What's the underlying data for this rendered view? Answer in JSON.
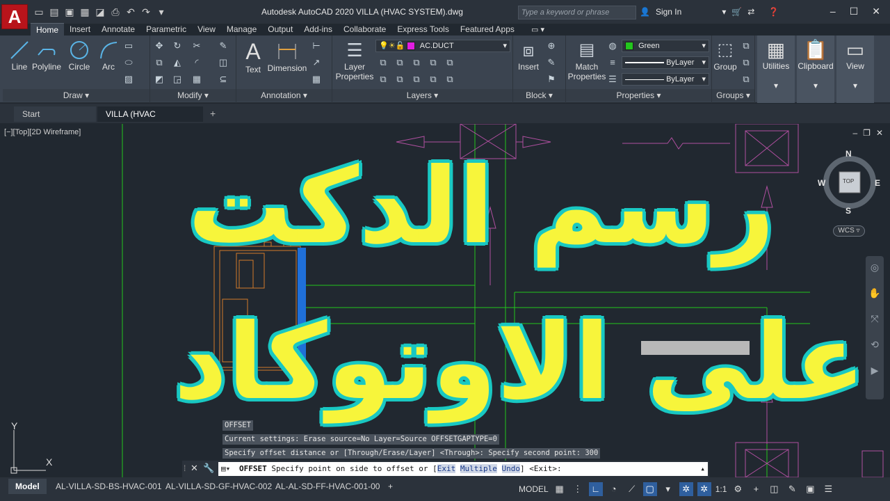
{
  "app": {
    "logo_letter": "A",
    "title": "Autodesk AutoCAD 2020    VILLA (HVAC SYSTEM).dwg",
    "search_placeholder": "Type a keyword or phrase",
    "sign_in": "Sign In"
  },
  "ribbon_tabs": [
    "Home",
    "Insert",
    "Annotate",
    "Parametric",
    "View",
    "Manage",
    "Output",
    "Add-ins",
    "Collaborate",
    "Express Tools",
    "Featured Apps"
  ],
  "panels": {
    "draw": {
      "title": "Draw",
      "tools": [
        "Line",
        "Polyline",
        "Circle",
        "Arc"
      ]
    },
    "modify": {
      "title": "Modify"
    },
    "annotation": {
      "title": "Annotation",
      "tools": [
        "Text",
        "Dimension"
      ]
    },
    "layers": {
      "title": "Layers",
      "layer_properties": "Layer Properties",
      "current_layer": "AC.DUCT"
    },
    "block": {
      "title": "Block",
      "insert": "Insert"
    },
    "properties": {
      "title": "Properties",
      "match": "Match Properties",
      "color": "Green",
      "linetype": "ByLayer",
      "lineweight": "ByLayer"
    },
    "groups": {
      "title": "Groups",
      "group": "Group"
    },
    "utilities": "Utilities",
    "clipboard": "Clipboard",
    "view": "View"
  },
  "doc_tabs": {
    "start": "Start",
    "active": "VILLA (HVAC SYSTEM)*"
  },
  "viewport": {
    "label": "[−][Top][2D Wireframe]",
    "compass": {
      "n": "N",
      "s": "S",
      "e": "E",
      "w": "W",
      "top": "TOP"
    },
    "wcs": "WCS",
    "ucs_y": "Y",
    "ucs_x": "X"
  },
  "overlay": {
    "line1": "رسم الدكت",
    "line2": "على الاوتوكاد"
  },
  "command_history": [
    "OFFSET",
    "Current settings: Erase source=No  Layer=Source  OFFSETGAPTYPE=0",
    "Specify offset distance or [Through/Erase/Layer] <Through>:  Specify second point: 300"
  ],
  "command_line": {
    "cmd": "OFFSET",
    "prompt": " Specify point on side to offset or [",
    "opt1": "Exit",
    "opt2": "Multiple",
    "opt3": "Undo",
    "tail": "] <Exit>:"
  },
  "layout_tabs": [
    "Model",
    "AL-VILLA-SD-BS-HVAC-001",
    "AL-VILLA-SD-GF-HVAC-002",
    "AL-AL-SD-FF-HVAC-001-00"
  ],
  "status": {
    "model": "MODEL",
    "scale": "1:1"
  },
  "colors": {
    "layer_swatch": "#e11de1",
    "green_swatch": "#22c61d",
    "overlay_fill": "#f7f53b",
    "overlay_outline": "#19c8c2"
  }
}
